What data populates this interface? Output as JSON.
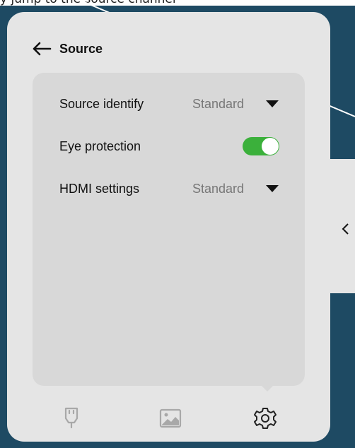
{
  "background_text": "y jump to the source channel",
  "header": {
    "back_label": "Source"
  },
  "settings": [
    {
      "label": "Source identify",
      "value": "Standard",
      "control": "dropdown"
    },
    {
      "label": "Eye protection",
      "control": "toggle",
      "enabled": true
    },
    {
      "label": "HDMI settings",
      "value": "Standard",
      "control": "dropdown"
    }
  ],
  "bottom_tabs": [
    {
      "icon": "plug-icon",
      "active": false
    },
    {
      "icon": "image-icon",
      "active": false
    },
    {
      "icon": "gear-icon",
      "active": true
    }
  ],
  "colors": {
    "backdrop": "#1e4a63",
    "panel": "#e5e5e5",
    "card": "#d8d8d8",
    "toggle_on": "#3bb03b"
  }
}
